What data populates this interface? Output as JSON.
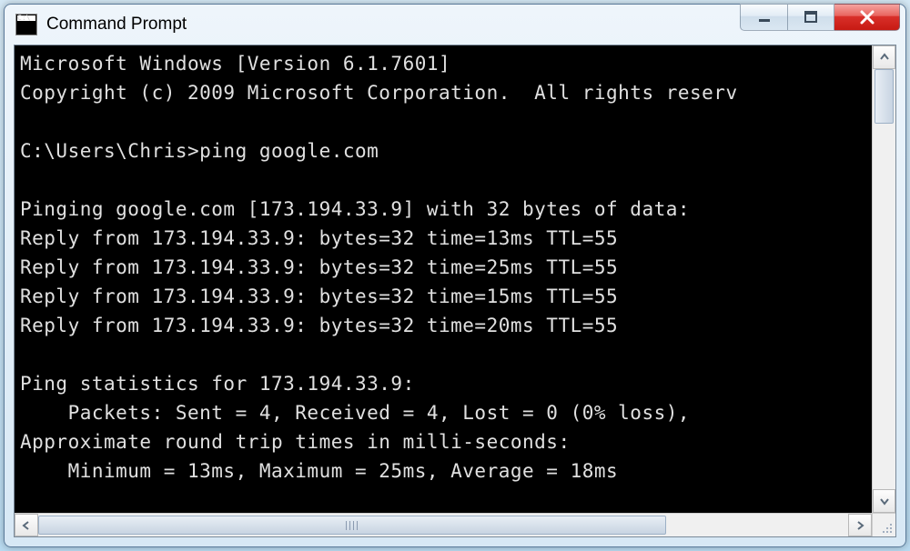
{
  "window": {
    "title": "Command Prompt"
  },
  "console": {
    "lines": [
      "Microsoft Windows [Version 6.1.7601]",
      "Copyright (c) 2009 Microsoft Corporation.  All rights reserv",
      "",
      "C:\\Users\\Chris>ping google.com",
      "",
      "Pinging google.com [173.194.33.9] with 32 bytes of data:",
      "Reply from 173.194.33.9: bytes=32 time=13ms TTL=55",
      "Reply from 173.194.33.9: bytes=32 time=25ms TTL=55",
      "Reply from 173.194.33.9: bytes=32 time=15ms TTL=55",
      "Reply from 173.194.33.9: bytes=32 time=20ms TTL=55",
      "",
      "Ping statistics for 173.194.33.9:",
      "    Packets: Sent = 4, Received = 4, Lost = 0 (0% loss),",
      "Approximate round trip times in milli-seconds:",
      "    Minimum = 13ms, Maximum = 25ms, Average = 18ms",
      ""
    ]
  }
}
